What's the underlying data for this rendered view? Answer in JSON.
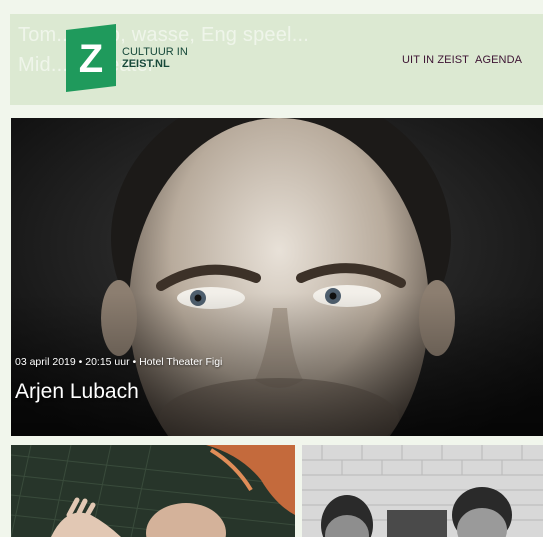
{
  "header": {
    "background_text_line1": "Tom..., Zap, wasse, Eng speel...",
    "background_text_line2": "Mid...                    ...theater",
    "logo": {
      "letter": "Z",
      "line1": "CULTUUR IN",
      "line2": "ZEIST.NL",
      "color": "#1f9a5c"
    },
    "nav": {
      "items": [
        {
          "label": "UIT IN ZEIST"
        },
        {
          "label": "AGENDA"
        }
      ]
    }
  },
  "hero": {
    "meta": "03 april 2019 • 20:15 uur • Hotel Theater Figi",
    "title": "Arjen Lubach",
    "image": "portrait-photo"
  },
  "cards": [
    {
      "image": "dancer-photo"
    },
    {
      "image": "performers-photo"
    }
  ],
  "colors": {
    "header_bg": "#dce9d2",
    "page_bg": "#f1f6ec",
    "nav_text": "#3d1433"
  }
}
